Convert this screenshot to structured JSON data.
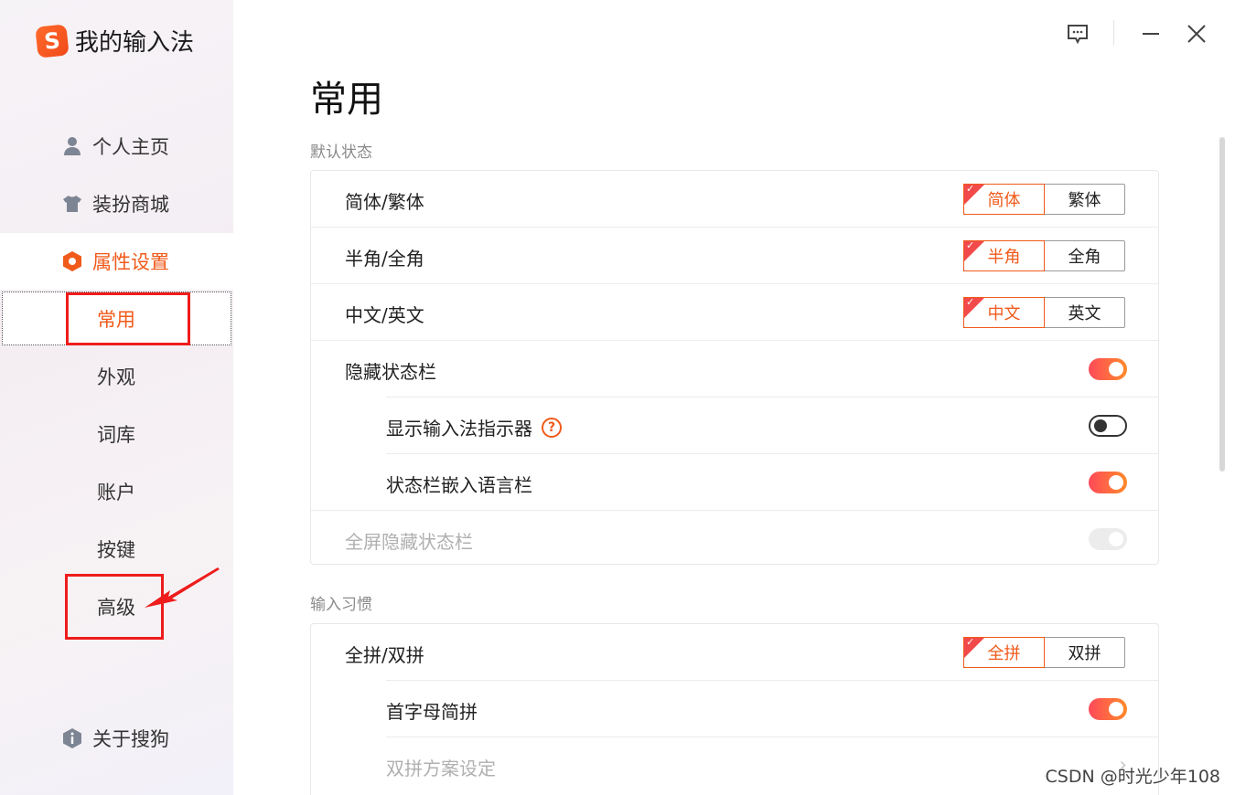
{
  "app": {
    "title": "我的输入法",
    "logo_letter": "S"
  },
  "sidebar": {
    "nav": [
      {
        "label": "个人主页",
        "icon": "user-icon"
      },
      {
        "label": "装扮商城",
        "icon": "shirt-icon"
      },
      {
        "label": "属性设置",
        "icon": "settings-hex-icon"
      }
    ],
    "sub": [
      "常用",
      "外观",
      "词库",
      "账户",
      "按键",
      "高级"
    ],
    "about": {
      "label": "关于搜狗",
      "icon": "info-icon"
    }
  },
  "main": {
    "title": "常用",
    "sections": [
      {
        "label": "默认状态",
        "rows": [
          {
            "label": "简体/繁体",
            "control": "segment",
            "options": [
              "简体",
              "繁体"
            ],
            "selected": 0
          },
          {
            "label": "半角/全角",
            "control": "segment",
            "options": [
              "半角",
              "全角"
            ],
            "selected": 0
          },
          {
            "label": "中文/英文",
            "control": "segment",
            "options": [
              "中文",
              "英文"
            ],
            "selected": 0
          },
          {
            "label": "隐藏状态栏",
            "control": "toggle",
            "state": "on"
          },
          {
            "label": "显示输入法指示器",
            "control": "toggle",
            "state": "off",
            "indent": true,
            "help": "?"
          },
          {
            "label": "状态栏嵌入语言栏",
            "control": "toggle",
            "state": "on",
            "indent": true
          },
          {
            "label": "全屏隐藏状态栏",
            "control": "toggle",
            "state": "disabled"
          }
        ]
      },
      {
        "label": "输入习惯",
        "rows": [
          {
            "label": "全拼/双拼",
            "control": "segment",
            "options": [
              "全拼",
              "双拼"
            ],
            "selected": 0
          },
          {
            "label": "首字母简拼",
            "control": "toggle",
            "state": "on",
            "indent": true
          },
          {
            "label": "双拼方案设定",
            "control": "chevron",
            "indent": true,
            "disabled": true
          }
        ]
      }
    ]
  },
  "window": {
    "feedback_icon": "feedback-icon",
    "minimize_icon": "minimize-icon",
    "close_icon": "close-icon"
  },
  "watermark": "CSDN @时光少年108",
  "colors": {
    "accent": "#f05a1a",
    "toggle_on_start": "#ff4a5a",
    "toggle_on_end": "#ff8a2a",
    "annotation_red": "#ee1c1c"
  }
}
